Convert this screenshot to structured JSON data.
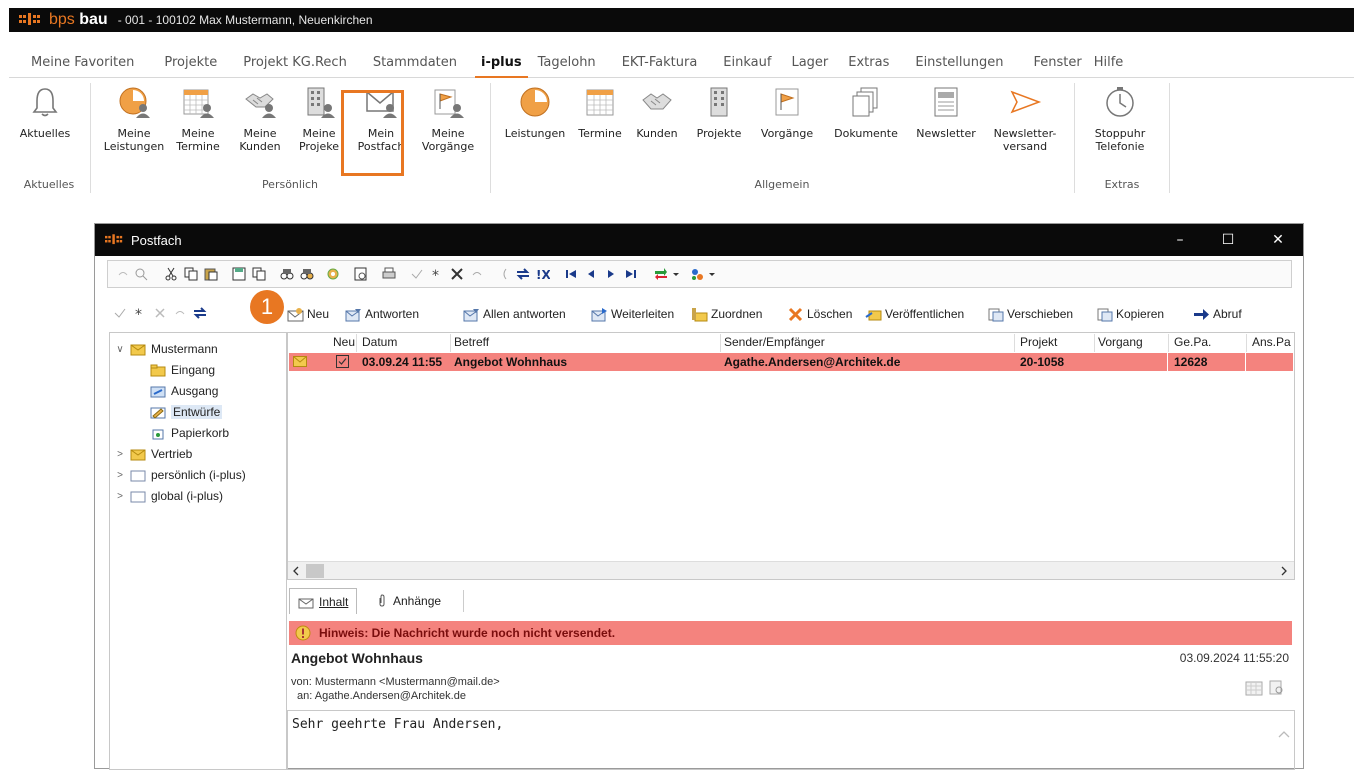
{
  "app": {
    "brand_prefix": "bps",
    "brand_name": "bau",
    "title": "- 001 - 100102 Max Mustermann, Neuenkirchen"
  },
  "menu": [
    "Meine Favoriten",
    "Projekte",
    "Projekt KG.Rech",
    "Stammdaten",
    "i-plus",
    "Tagelohn",
    "EKT-Faktura",
    "Einkauf",
    "Lager",
    "Extras",
    "Einstellungen",
    "Fenster",
    "Hilfe"
  ],
  "menu_active": "i-plus",
  "ribbon": {
    "buttons": [
      {
        "l1": "Aktuelles",
        "l2": "",
        "icon": "bell-icon"
      },
      {
        "l1": "Meine",
        "l2": "Leistungen",
        "icon": "clock-person-icon"
      },
      {
        "l1": "Meine",
        "l2": "Termine",
        "icon": "calendar-person-icon"
      },
      {
        "l1": "Meine",
        "l2": "Kunden",
        "icon": "handshake-person-icon"
      },
      {
        "l1": "Meine",
        "l2": "Projeke",
        "icon": "building-person-icon"
      },
      {
        "l1": "Mein",
        "l2": "Postfach",
        "icon": "mail-person-icon"
      },
      {
        "l1": "Meine",
        "l2": "Vorgänge",
        "icon": "flag-person-icon"
      },
      {
        "l1": "Leistungen",
        "l2": "",
        "icon": "clock-icon"
      },
      {
        "l1": "Termine",
        "l2": "",
        "icon": "calendar-icon"
      },
      {
        "l1": "Kunden",
        "l2": "",
        "icon": "handshake-icon"
      },
      {
        "l1": "Projekte",
        "l2": "",
        "icon": "building-icon"
      },
      {
        "l1": "Vorgänge",
        "l2": "",
        "icon": "flag-icon"
      },
      {
        "l1": "Dokumente",
        "l2": "",
        "icon": "documents-icon"
      },
      {
        "l1": "Newsletter",
        "l2": "",
        "icon": "newsletter-icon"
      },
      {
        "l1": "Newsletter-",
        "l2": "versand",
        "icon": "send-icon"
      },
      {
        "l1": "Stoppuhr",
        "l2": "Telefonie",
        "icon": "stopwatch-icon"
      }
    ],
    "groups": [
      "Aktuelles",
      "Persönlich",
      "Allgemein",
      "Extras"
    ]
  },
  "window": {
    "title": "Postfach",
    "controls": [
      "–",
      "☐",
      "✕"
    ]
  },
  "toolbar2": {
    "buttons": [
      "Neu",
      "Antworten",
      "Allen antworten",
      "Weiterleiten",
      "Zuordnen",
      "Löschen",
      "Veröffentlichen",
      "Verschieben",
      "Kopieren",
      "Abruf"
    ]
  },
  "badge": "1",
  "tree": [
    {
      "label": "Mustermann",
      "level": 0,
      "exp": "∨"
    },
    {
      "label": "Eingang",
      "level": 1,
      "exp": ""
    },
    {
      "label": "Ausgang",
      "level": 1,
      "exp": ""
    },
    {
      "label": "Entwürfe",
      "level": 1,
      "exp": ""
    },
    {
      "label": "Papierkorb",
      "level": 1,
      "exp": ""
    },
    {
      "label": "Vertrieb",
      "level": 0,
      "exp": ">"
    },
    {
      "label": "persönlich (i-plus)",
      "level": 0,
      "exp": ">"
    },
    {
      "label": "global (i-plus)",
      "level": 0,
      "exp": ">"
    }
  ],
  "list": {
    "columns": [
      "Neu",
      "Datum",
      "Betreff",
      "Sender/Empfänger",
      "Projekt",
      "Vorgang",
      "Ge.Pa.",
      "Ans.Pa"
    ],
    "rows": [
      {
        "datum": "03.09.24 11:55",
        "betreff": "Angebot Wohnhaus",
        "sender": "Agathe.Andersen@Architek.de",
        "projekt": "20-1058",
        "vorgang": "",
        "gepa": "12628",
        "anspa": ""
      }
    ]
  },
  "tabs": [
    "Inhalt",
    "Anhänge"
  ],
  "message": {
    "hint": "Hinweis: Die Nachricht wurde noch nicht versendet.",
    "subject": "Angebot Wohnhaus",
    "date": "03.09.2024 11:55:20",
    "from": "von: Mustermann <Mustermann@mail.de>",
    "to": "an: Agathe.Andersen@Architek.de",
    "body": "Sehr geehrte Frau Andersen,"
  },
  "colors": {
    "accent": "#e87722",
    "row_highlight": "#f4837e",
    "titlebar": "#0a0a0a"
  }
}
